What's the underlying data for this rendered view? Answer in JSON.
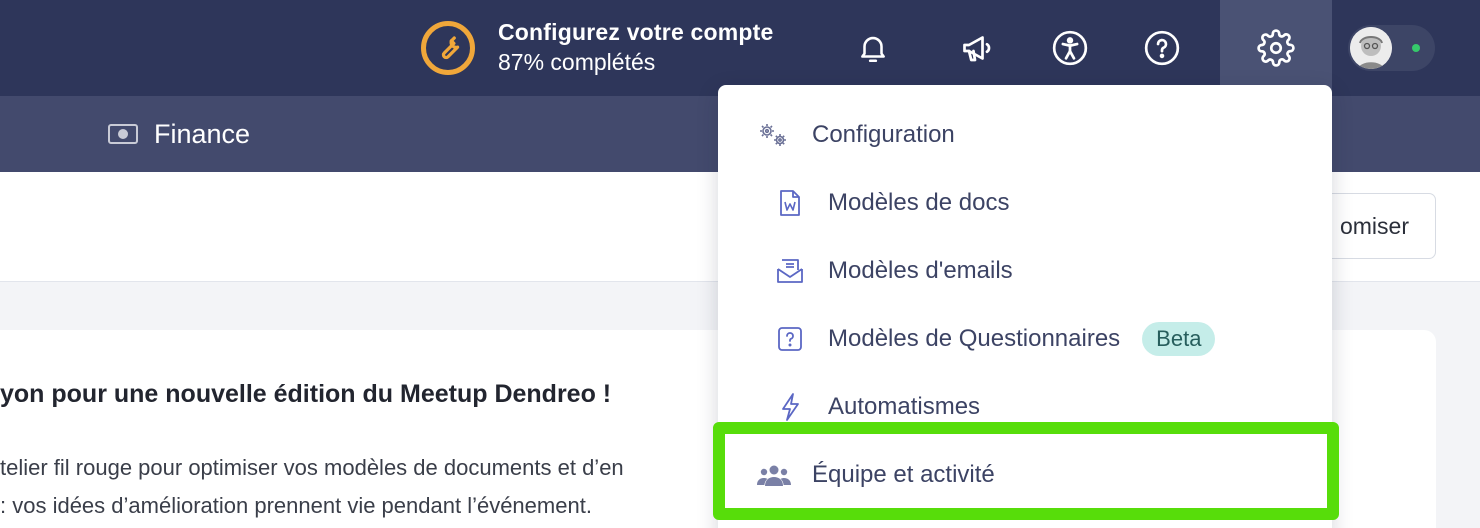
{
  "topbar": {
    "setup_title": "Configurez votre compte",
    "setup_progress_label": "87% complétés",
    "setup_progress": 0.87,
    "icons": [
      "wrench-icon",
      "bell-icon",
      "megaphone-icon",
      "accessibility-icon",
      "help-icon",
      "gear-icon"
    ],
    "accent_color": "#f0a73a",
    "status_color": "#36c96b"
  },
  "subnav": {
    "finance_label": "Finance"
  },
  "toolbar": {
    "customize_label": "omiser"
  },
  "card": {
    "title": "yon pour une nouvelle édition du Meetup Dendreo !",
    "lines": [
      "telier fil rouge pour optimiser vos modèles de documents et d’en",
      ": vos idées d’amélioration prennent vie pendant l’événement."
    ]
  },
  "menu": {
    "items": [
      {
        "label": "Configuration",
        "icon": "gears-icon"
      },
      {
        "label": "Modèles de docs",
        "icon": "word-doc-icon"
      },
      {
        "label": "Modèles d'emails",
        "icon": "email-icon"
      },
      {
        "label": "Modèles de Questionnaires",
        "icon": "question-box-icon",
        "badge": "Beta"
      },
      {
        "label": "Automatismes",
        "icon": "bolt-icon"
      },
      {
        "label": "Équipe et activité",
        "icon": "team-icon"
      }
    ],
    "highlight_color": "#57dd0a",
    "badge_color": "#c5ede9"
  }
}
